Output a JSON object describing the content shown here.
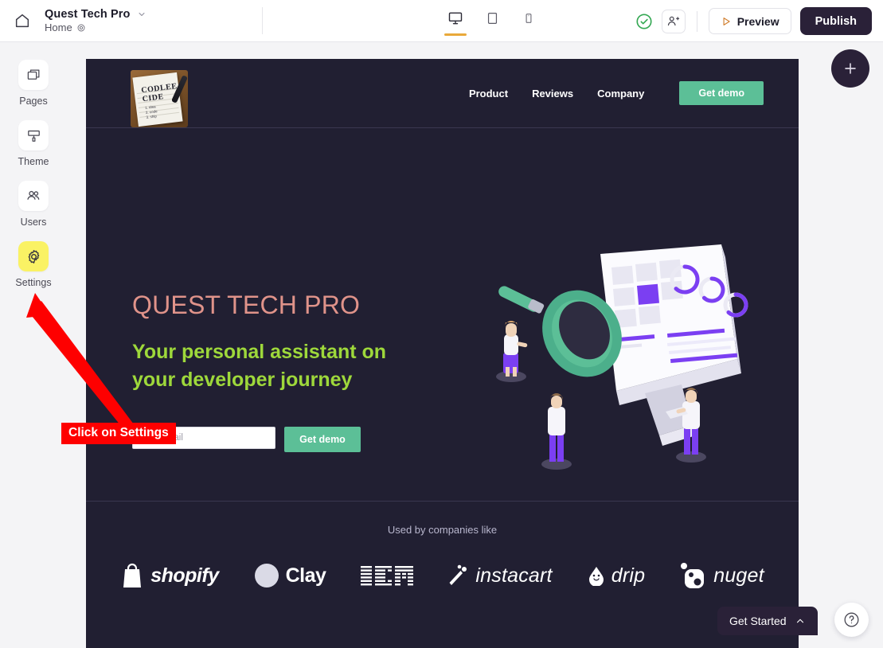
{
  "topbar": {
    "home_icon": "home-icon",
    "site_title": "Quest Tech Pro",
    "page_name": "Home",
    "page_settings_icon": "gear-icon",
    "chevron_icon": "chevron-down-icon",
    "devices": [
      {
        "name": "desktop",
        "icon": "desktop-icon",
        "active": true
      },
      {
        "name": "tablet",
        "icon": "tablet-icon",
        "active": false
      },
      {
        "name": "mobile",
        "icon": "mobile-icon",
        "active": false
      }
    ],
    "status_icon": "check-circle-icon",
    "status_color": "#34a853",
    "invite_icon": "add-user-icon",
    "preview_label": "Preview",
    "preview_icon": "play-icon",
    "publish_label": "Publish",
    "publish_color": "#2a2138"
  },
  "sidebar": {
    "items": [
      {
        "label": "Pages",
        "icon": "pages-icon",
        "highlighted": false
      },
      {
        "label": "Theme",
        "icon": "brush-icon",
        "highlighted": false
      },
      {
        "label": "Users",
        "icon": "users-icon",
        "highlighted": false
      },
      {
        "label": "Settings",
        "icon": "gear-icon",
        "highlighted": true
      }
    ],
    "highlight_color": "#faf264"
  },
  "canvas": {
    "background": "#211f32",
    "site_header": {
      "logo_alt": "notepad-with-pen-logo",
      "logo_text_line1": "CODLEE",
      "logo_text_line2": "CIDE",
      "nav_links": [
        "Product",
        "Reviews",
        "Company"
      ],
      "cta_label": "Get demo",
      "cta_color": "#5cbf97"
    },
    "hero": {
      "title": "QUEST TECH PRO",
      "title_color": "#e0938a",
      "subtitle": "Your personal assistant on your developer journey",
      "subtitle_color": "#9ed83b",
      "email_placeholder": "Your email",
      "email_value": "",
      "cta_label": "Get demo",
      "illustration_alt": "isometric-magnifier-monitor-people-illustration"
    },
    "logos_band": {
      "title": "Used by companies like",
      "brands": [
        "shopify",
        "Clay",
        "IBM",
        "instacart",
        "drip",
        "nuget"
      ]
    }
  },
  "overlays": {
    "add_button_icon": "plus-icon",
    "get_started_label": "Get Started",
    "get_started_chevron": "chevron-up-icon",
    "help_icon": "question-mark-icon"
  },
  "annotation": {
    "label": "Click on Settings",
    "color": "#fe0000"
  }
}
